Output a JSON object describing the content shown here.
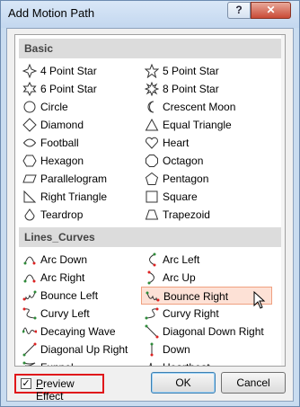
{
  "window": {
    "title": "Add Motion Path",
    "help_label": "?",
    "close_label": "✕"
  },
  "groups": [
    {
      "name": "Basic",
      "items": [
        {
          "label": "4 Point Star",
          "icon": "four-point-star-icon",
          "col": 0
        },
        {
          "label": "5 Point Star",
          "icon": "five-point-star-icon",
          "col": 1
        },
        {
          "label": "6 Point Star",
          "icon": "six-point-star-icon",
          "col": 0
        },
        {
          "label": "8 Point Star",
          "icon": "eight-point-star-icon",
          "col": 1
        },
        {
          "label": "Circle",
          "icon": "circle-icon",
          "col": 0
        },
        {
          "label": "Crescent Moon",
          "icon": "crescent-moon-icon",
          "col": 1
        },
        {
          "label": "Diamond",
          "icon": "diamond-icon",
          "col": 0
        },
        {
          "label": "Equal Triangle",
          "icon": "equal-triangle-icon",
          "col": 1
        },
        {
          "label": "Football",
          "icon": "football-icon",
          "col": 0
        },
        {
          "label": "Heart",
          "icon": "heart-icon",
          "col": 1
        },
        {
          "label": "Hexagon",
          "icon": "hexagon-icon",
          "col": 0
        },
        {
          "label": "Octagon",
          "icon": "octagon-icon",
          "col": 1
        },
        {
          "label": "Parallelogram",
          "icon": "parallelogram-icon",
          "col": 0
        },
        {
          "label": "Pentagon",
          "icon": "pentagon-icon",
          "col": 1
        },
        {
          "label": "Right Triangle",
          "icon": "right-triangle-icon",
          "col": 0
        },
        {
          "label": "Square",
          "icon": "square-icon",
          "col": 1
        },
        {
          "label": "Teardrop",
          "icon": "teardrop-icon",
          "col": 0
        },
        {
          "label": "Trapezoid",
          "icon": "trapezoid-icon",
          "col": 1
        }
      ]
    },
    {
      "name": "Lines_Curves",
      "items": [
        {
          "label": "Arc Down",
          "icon": "arc-down-icon",
          "col": 0
        },
        {
          "label": "Arc Left",
          "icon": "arc-left-icon",
          "col": 1
        },
        {
          "label": "Arc Right",
          "icon": "arc-right-icon",
          "col": 0
        },
        {
          "label": "Arc Up",
          "icon": "arc-up-icon",
          "col": 1
        },
        {
          "label": "Bounce Left",
          "icon": "bounce-left-icon",
          "col": 0
        },
        {
          "label": "Bounce Right",
          "icon": "bounce-right-icon",
          "col": 1,
          "selected": true
        },
        {
          "label": "Curvy Left",
          "icon": "curvy-left-icon",
          "col": 0
        },
        {
          "label": "Curvy Right",
          "icon": "curvy-right-icon",
          "col": 1
        },
        {
          "label": "Decaying Wave",
          "icon": "decaying-wave-icon",
          "col": 0
        },
        {
          "label": "Diagonal Down Right",
          "icon": "diagonal-down-right-icon",
          "col": 1
        },
        {
          "label": "Diagonal Up Right",
          "icon": "diagonal-up-right-icon",
          "col": 0
        },
        {
          "label": "Down",
          "icon": "down-icon",
          "col": 1
        },
        {
          "label": "Funnel",
          "icon": "funnel-icon",
          "col": 0
        },
        {
          "label": "Heartbeat",
          "icon": "heartbeat-icon",
          "col": 1
        }
      ]
    }
  ],
  "preview": {
    "label_prefix": "",
    "label_underline": "P",
    "label_rest": "review Effect",
    "checked": true
  },
  "buttons": {
    "ok": "OK",
    "cancel": "Cancel"
  },
  "colors": {
    "path_green": "#2e8b3a",
    "path_red": "#d22",
    "selected_bg": "#fde1d6"
  }
}
